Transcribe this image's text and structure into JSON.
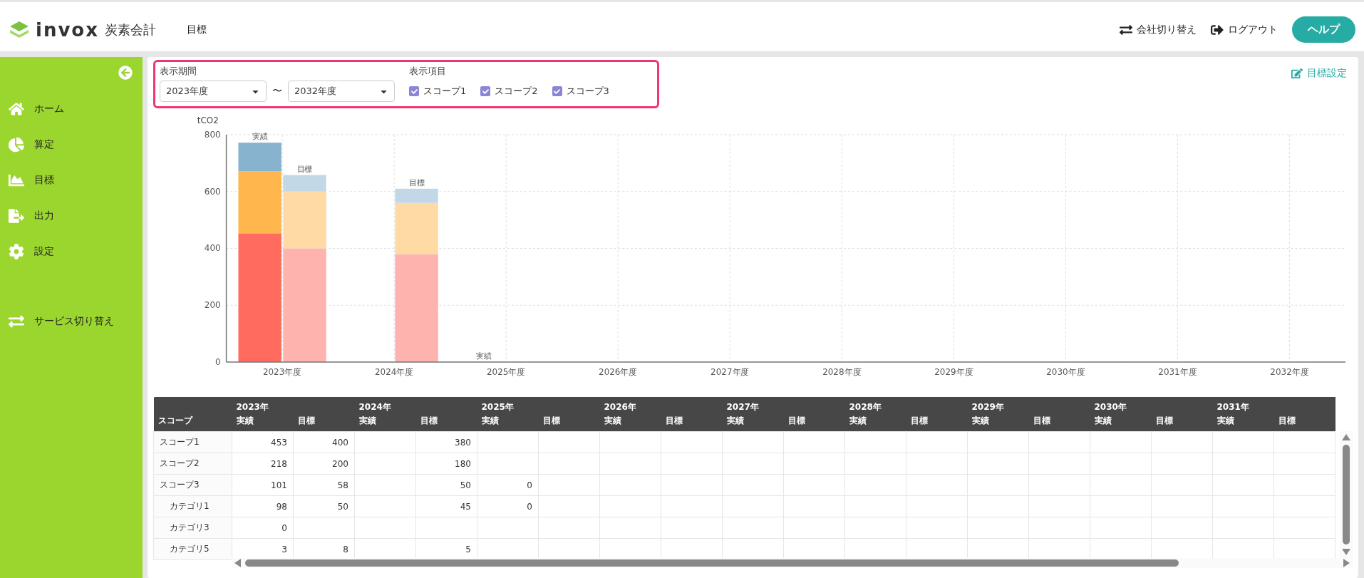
{
  "header": {
    "logo_text": "invox",
    "logo_sub": "炭素会計",
    "page_title": "目標",
    "actions": [
      {
        "kind": "switch",
        "label": "会社切り替え"
      },
      {
        "kind": "logout",
        "label": "ログアウト"
      }
    ],
    "help_button": "ヘルプ"
  },
  "sidebar": {
    "items": [
      {
        "kind": "home",
        "label": "ホーム",
        "selected": false
      },
      {
        "kind": "calc",
        "label": "算定",
        "selected": false
      },
      {
        "kind": "target",
        "label": "目標",
        "selected": false
      },
      {
        "kind": "output",
        "label": "出力",
        "selected": false
      },
      {
        "kind": "settings",
        "label": "設定",
        "selected": false
      },
      {
        "kind": "switch",
        "label": "サービス切り替え",
        "selected": false
      }
    ]
  },
  "filters": {
    "period_label": "表示期間",
    "from": "2023年度",
    "separator": "〜",
    "to": "2032年度",
    "items_label": "表示項目",
    "items": [
      {
        "label": "スコープ1",
        "checked": true
      },
      {
        "label": "スコープ2",
        "checked": true
      },
      {
        "label": "スコープ3",
        "checked": true
      }
    ]
  },
  "target_settings_link": "目標設定",
  "chart": {
    "chart_data": {
      "type": "bar",
      "stacked": true,
      "grid": true,
      "ylabel": "tCO2",
      "ylim": [
        0,
        800
      ],
      "yticks": [
        0,
        200,
        400,
        600,
        800
      ],
      "xlim": [
        2022.5,
        2032.5
      ],
      "xticks": [
        {
          "value": 2023,
          "label": "2023年度"
        },
        {
          "value": 2024,
          "label": "2024年度"
        },
        {
          "value": 2025,
          "label": "2025年度"
        },
        {
          "value": 2026,
          "label": "2026年度"
        },
        {
          "value": 2027,
          "label": "2027年度"
        },
        {
          "value": 2028,
          "label": "2028年度"
        },
        {
          "value": 2029,
          "label": "2029年度"
        },
        {
          "value": 2030,
          "label": "2030年度"
        },
        {
          "value": 2031,
          "label": "2031年度"
        },
        {
          "value": 2032,
          "label": "2032年度"
        }
      ],
      "x": [
        2022.8,
        2023.2,
        2024.2,
        2024.8
      ],
      "series": [
        {
          "color": "#ff6b5f",
          "values": [
            453,
            null,
            null,
            null
          ]
        },
        {
          "color": "#ffb74d",
          "values": [
            218,
            null,
            null,
            null
          ]
        },
        {
          "color": "#88b3cf",
          "values": [
            101,
            null,
            null,
            0
          ]
        },
        {
          "color": "#ffb3ae",
          "values": [
            null,
            400,
            380,
            null
          ]
        },
        {
          "color": "#ffdaa5",
          "values": [
            null,
            200,
            180,
            null
          ]
        },
        {
          "color": "#c3d8e7",
          "values": [
            null,
            58,
            50,
            null
          ]
        }
      ],
      "annotations": [
        {
          "x": 2022.8,
          "y": 772,
          "text": "実績"
        },
        {
          "x": 2023.2,
          "y": 658,
          "text": "目標"
        },
        {
          "x": 2024.2,
          "y": 610,
          "text": "目標"
        },
        {
          "x": 2024.8,
          "y": 0,
          "text": "実績"
        }
      ]
    }
  },
  "table": {
    "first_column": "スコープ",
    "years": [
      {
        "year": "2023年",
        "sub": [
          "実績",
          "目標"
        ]
      },
      {
        "year": "2024年",
        "sub": [
          "実績",
          "目標"
        ]
      },
      {
        "year": "2025年",
        "sub": [
          "実績",
          "目標"
        ]
      },
      {
        "year": "2026年",
        "sub": [
          "実績",
          "目標"
        ]
      },
      {
        "year": "2027年",
        "sub": [
          "実績",
          "目標"
        ]
      },
      {
        "year": "2028年",
        "sub": [
          "実績",
          "目標"
        ]
      },
      {
        "year": "2029年",
        "sub": [
          "実績",
          "目標"
        ]
      },
      {
        "year": "2030年",
        "sub": [
          "実績",
          "目標"
        ]
      },
      {
        "year": "2031年",
        "sub": [
          "実績",
          "目標"
        ]
      }
    ],
    "rows": [
      {
        "scope": "スコープ1",
        "by_year": [
          {
            "actual": "453",
            "target": "400"
          },
          {
            "target": "380"
          }
        ]
      },
      {
        "scope": "スコープ2",
        "by_year": [
          {
            "actual": "218",
            "target": "200"
          },
          {
            "target": "180"
          }
        ]
      },
      {
        "scope": "スコープ3",
        "by_year": [
          {
            "actual": "101",
            "target": "58"
          },
          {
            "target": "50"
          },
          {
            "actual": "0"
          }
        ],
        "children": [
          {
            "scope": "カテゴリ1",
            "by_year": [
              {
                "actual": "98",
                "target": "50"
              },
              {
                "target": "45"
              },
              {
                "actual": "0"
              }
            ]
          },
          {
            "scope": "カテゴリ3",
            "by_year": [
              {
                "actual": "0"
              }
            ]
          },
          {
            "scope": "カテゴリ5",
            "by_year": [
              {
                "actual": "3",
                "target": "8"
              },
              {
                "target": "5"
              }
            ]
          }
        ]
      }
    ]
  }
}
